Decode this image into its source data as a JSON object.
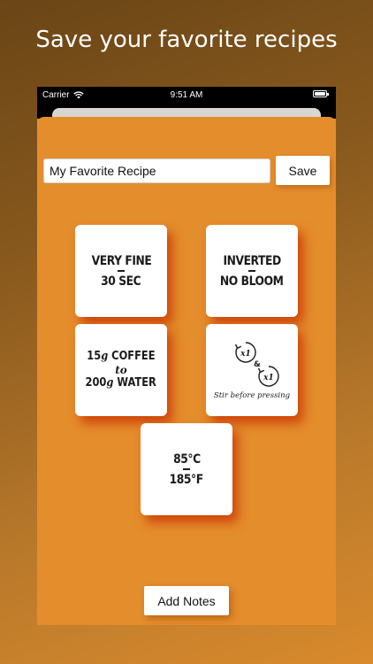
{
  "promo": {
    "headline": "Save your favorite recipes"
  },
  "status_bar": {
    "carrier": "Carrier",
    "time": "9:51 AM"
  },
  "recipe": {
    "name": "My Favorite Recipe",
    "save_label": "Save"
  },
  "cards": {
    "grind": {
      "line1": "VERY FINE",
      "line2": "30 SEC"
    },
    "method": {
      "line1": "INVERTED",
      "line2": "NO BLOOM"
    },
    "ratio": {
      "coffee_amount": "15",
      "unit": "g",
      "coffee_label": "COFFEE",
      "to_label": "to",
      "water_amount": "200",
      "water_label": "WATER"
    },
    "stir": {
      "first_count": "x1",
      "ampersand": "&",
      "second_count": "x1",
      "caption": "Stir before pressing"
    },
    "temperature": {
      "celsius": "85°C",
      "fahrenheit": "185°F"
    }
  },
  "notes": {
    "label": "Add Notes"
  },
  "colors": {
    "accent": "#e48d2c",
    "card_shadow": "#d23a00",
    "background_dark": "#6a4516"
  },
  "icons": {
    "stir": "clockwise-arrow-icon",
    "wifi": "wifi-icon",
    "battery": "battery-icon"
  }
}
